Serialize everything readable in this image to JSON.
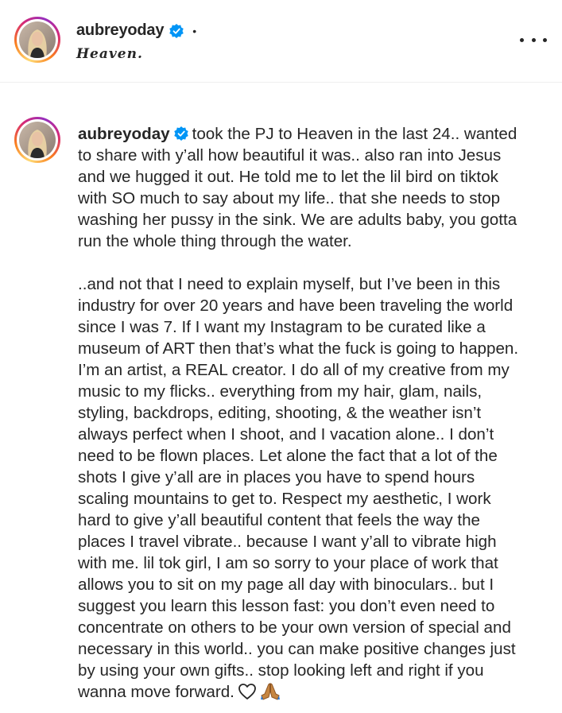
{
  "header": {
    "username": "aubreyoday",
    "separator": "•",
    "location": "Heaven."
  },
  "post": {
    "username": "aubreyoday",
    "caption_lines_1": "took the PJ to Heaven in the last 24.. wanted\nto share with y’all how beautiful it was.. also ran into Jesus\nand we hugged it out. He told me to let the lil bird on tiktok\nwith SO much to say about my life.. that she needs to stop\nwashing her pussy in the sink. We are adults baby, you gotta\nrun the whole thing through the water.",
    "caption_lines_2": "..and not that I need to explain myself, but I’ve been in this\nindustry for over 20 years and have been traveling the world\nsince I was 7. If I want my Instagram to be curated like a\nmuseum of ART then that’s what the fuck is going to happen.\nI’m an artist, a REAL creator. I do all of my creative from my\nmusic to my flicks.. everything from my hair, glam, nails,\nstyling, backdrops, editing, shooting, & the weather isn’t\nalways perfect when I shoot, and I vacation alone.. I don’t\nneed to be flown places. Let alone the fact that a lot of the\nshots I give y’all are in places you have to spend hours\nscaling mountains to get to. Respect my aesthetic, I work\nhard to give y’all beautiful content that feels the way the\nplaces I travel vibrate.. because I want y’all to vibrate high\nwith me. lil tok girl, I am so sorry to your place of work that\nallows you to sit on my page all day with binoculars.. but I\nsuggest you learn this lesson fast: you don’t even need to\nconcentrate on others to be your own version of special and\nnecessary in this world.. you can make positive changes just\nby using your own gifts.. stop looking left and right if you\nwanna move forward."
  },
  "icons": {
    "verified": "verified-badge-icon",
    "more": "more-options-icon",
    "heart": "white-heart-emoji",
    "pray": "folded-hands-emoji"
  },
  "colors": {
    "verified_blue": "#0095f6",
    "text": "#262626",
    "divider": "#efefef"
  }
}
